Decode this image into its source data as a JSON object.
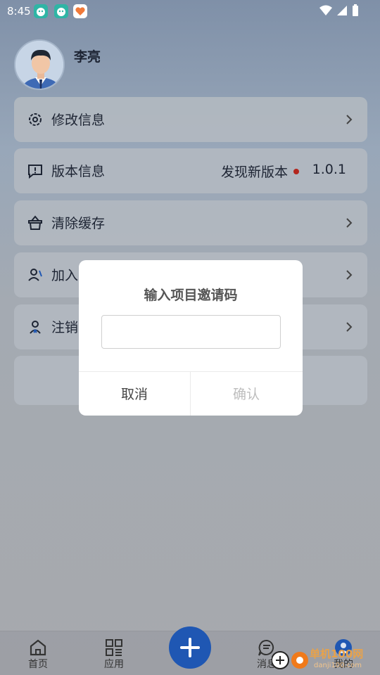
{
  "status_bar": {
    "time": "8:45"
  },
  "profile": {
    "name": "李亮"
  },
  "menu": [
    {
      "label": "修改信息",
      "icon": "settings-gear-icon"
    },
    {
      "label": "版本信息",
      "icon": "message-alert-icon",
      "extra": "发现新版本",
      "version": "1.0.1"
    },
    {
      "label": "清除缓存",
      "icon": "basket-icon"
    },
    {
      "label": "加入",
      "icon": "person-add-icon"
    },
    {
      "label": "注销",
      "icon": "person-logout-icon"
    }
  ],
  "dialog": {
    "title": "输入项目邀请码",
    "input_value": "",
    "cancel_label": "取消",
    "confirm_label": "确认"
  },
  "bottom_nav": {
    "home": "首页",
    "apps": "应用",
    "messages": "消息",
    "mine": "我的"
  },
  "watermark": {
    "text": "单机100网",
    "sub": "danji100.com"
  },
  "colors": {
    "accent": "#1f57b3",
    "dot": "#b3261e",
    "watermark": "#e8a24b"
  }
}
